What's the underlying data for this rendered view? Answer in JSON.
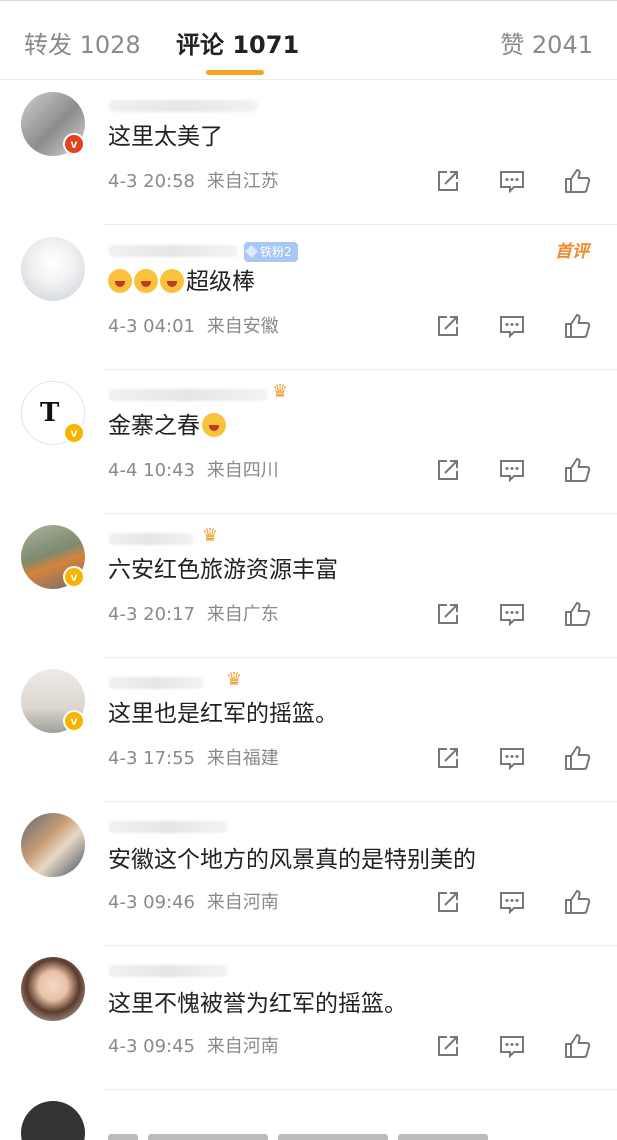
{
  "tabs": {
    "repost": "转发 1028",
    "comment": "评论 1071",
    "like": "赞 2041"
  },
  "comments": [
    {
      "text": "这里太美了",
      "time": "4-3 20:58",
      "location": "来自江苏",
      "badge": "red"
    },
    {
      "text": "超级棒",
      "fan_badge": "铁粉2",
      "first_tag": "首评",
      "time": "4-3 04:01",
      "location": "来自安徽"
    },
    {
      "text": "金寨之春",
      "time": "4-4 10:43",
      "location": "来自四川",
      "badge": "gold"
    },
    {
      "text": "六安红色旅游资源丰富",
      "time": "4-3 20:17",
      "location": "来自广东",
      "badge": "gold"
    },
    {
      "text": "这里也是红军的摇篮。",
      "time": "4-3 17:55",
      "location": "来自福建",
      "badge": "gold"
    },
    {
      "text": "安徽这个地方的风景真的是特别美的",
      "time": "4-3 09:46",
      "location": "来自河南"
    },
    {
      "text": "这里不愧被誉为红军的摇篮。",
      "time": "4-3 09:45",
      "location": "来自河南"
    }
  ],
  "icons": {
    "share": "share-icon",
    "reply": "comment-icon",
    "like": "thumbs-up-icon"
  },
  "colors": {
    "accent": "#f5a623",
    "verified_red": "#e2421e",
    "verified_gold": "#f7b500",
    "first_comment": "#f08a2c"
  }
}
